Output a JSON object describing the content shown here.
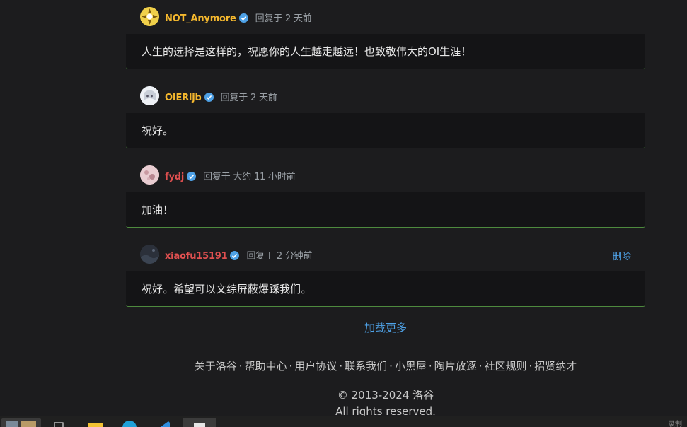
{
  "replies": [
    {
      "username": "NOT_Anymore",
      "username_color": "#f5b82e",
      "time": "回复于 2 天前",
      "content": "人生的选择是这样的，祝愿你的人生越走越远！也致敬伟大的OI生涯！",
      "avatar_icon": "sun-pattern-avatar"
    },
    {
      "username": "OIERljb",
      "username_color": "#f5b82e",
      "time": "回复于 2 天前",
      "content": "祝好。",
      "avatar_icon": "anime-avatar"
    },
    {
      "username": "fydj",
      "username_color": "#e05050",
      "time": "回复于 大约 11 小时前",
      "content": "加油！",
      "avatar_icon": "pink-avatar"
    },
    {
      "username": "xiaofu15191",
      "username_color": "#e05050",
      "time": "回复于 2 分钟前",
      "content": "祝好。希望可以文综屏蔽爆踩我们。",
      "avatar_icon": "dark-avatar",
      "delete_label": "删除"
    }
  ],
  "load_more_label": "加载更多",
  "footer": {
    "links": [
      "关于洛谷",
      "帮助中心",
      "用户协议",
      "联系我们",
      "小黑屋",
      "陶片放逐",
      "社区规则",
      "招贤纳才"
    ],
    "separator": "·",
    "copyright": "© 2013-2024 洛谷",
    "rights": "All rights reserved."
  },
  "taskbar": {
    "rec_label": "录制"
  },
  "colors": {
    "accent": "#4ea1e6",
    "verified_badge": "#4ea1e6",
    "border_green": "#4e8a3e"
  }
}
